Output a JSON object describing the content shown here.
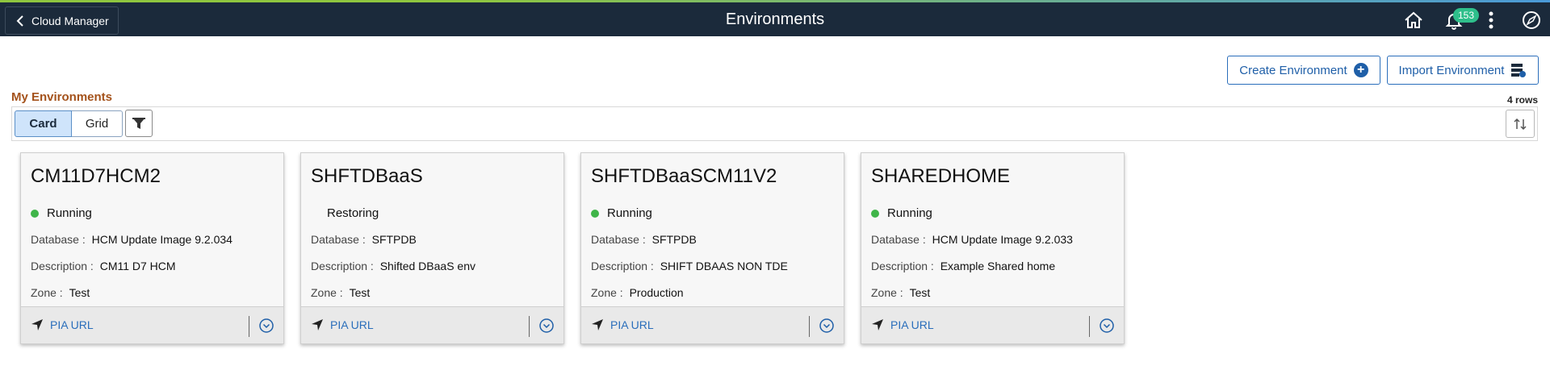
{
  "header": {
    "back_label": "Cloud Manager",
    "title": "Environments",
    "notification_count": "153"
  },
  "actions": {
    "create_label": "Create Environment",
    "import_label": "Import Environment"
  },
  "section": {
    "title": "My Environments",
    "row_count": "4 rows"
  },
  "view_tabs": {
    "card": "Card",
    "grid": "Grid",
    "selected": "Card"
  },
  "cards": [
    {
      "name": "CM11D7HCM2",
      "status": "Running",
      "status_color": "#3fb549",
      "database_label": "Database :",
      "database": "HCM Update Image 9.2.034",
      "description_label": "Description :",
      "description": "CM11 D7 HCM",
      "zone_label": "Zone :",
      "zone": "Test",
      "link": "PIA URL"
    },
    {
      "name": "SHFTDBaaS",
      "status": "Restoring",
      "status_color": "",
      "database_label": "Database :",
      "database": "SFTPDB",
      "description_label": "Description :",
      "description": "Shifted DBaaS env",
      "zone_label": "Zone :",
      "zone": "Test",
      "link": "PIA URL"
    },
    {
      "name": "SHFTDBaaSCM11V2",
      "status": "Running",
      "status_color": "#3fb549",
      "database_label": "Database :",
      "database": "SFTPDB",
      "description_label": "Description :",
      "description": "SHIFT DBAAS NON TDE",
      "zone_label": "Zone :",
      "zone": "Production",
      "link": "PIA URL"
    },
    {
      "name": "SHAREDHOME",
      "status": "Running",
      "status_color": "#3fb549",
      "database_label": "Database :",
      "database": "HCM Update Image 9.2.033",
      "description_label": "Description :",
      "description": "Example Shared home",
      "zone_label": "Zone :",
      "zone": "Test",
      "link": "PIA URL"
    }
  ],
  "colors": {
    "header_bg": "#1b2a3b",
    "accent": "#2a6ebb",
    "section_title": "#a4521b",
    "badge": "#2ebf8b"
  }
}
